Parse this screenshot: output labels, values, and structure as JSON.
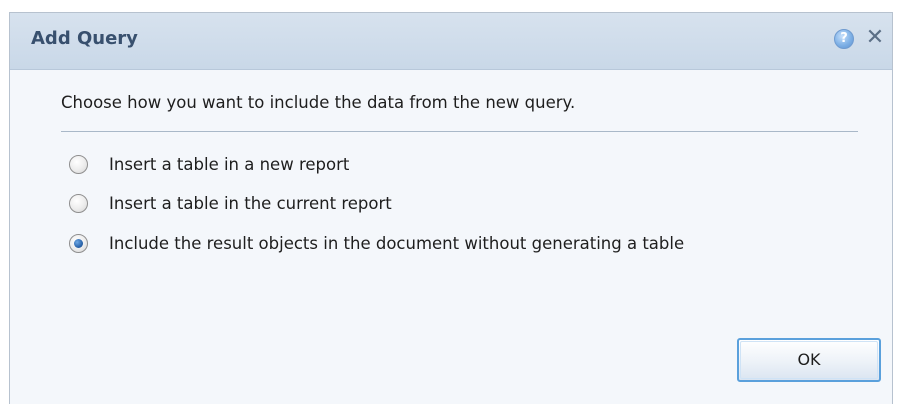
{
  "dialog": {
    "title": "Add Query",
    "help_icon": "help-icon",
    "help_glyph": "?",
    "close_icon": "close-icon",
    "close_glyph": "✕",
    "prompt": "Choose how you want to include the data from the new query.",
    "options": [
      {
        "label": "Insert a table in a new report",
        "selected": false
      },
      {
        "label": "Insert a table in the current report",
        "selected": false
      },
      {
        "label": "Include the result objects in the document without generating a table",
        "selected": true
      }
    ],
    "ok_label": "OK"
  },
  "colors": {
    "title_text": "#38506e",
    "titlebar_bg": "#d0ddeb",
    "body_bg": "#f4f7fb",
    "ok_border": "#5aa0dc"
  }
}
